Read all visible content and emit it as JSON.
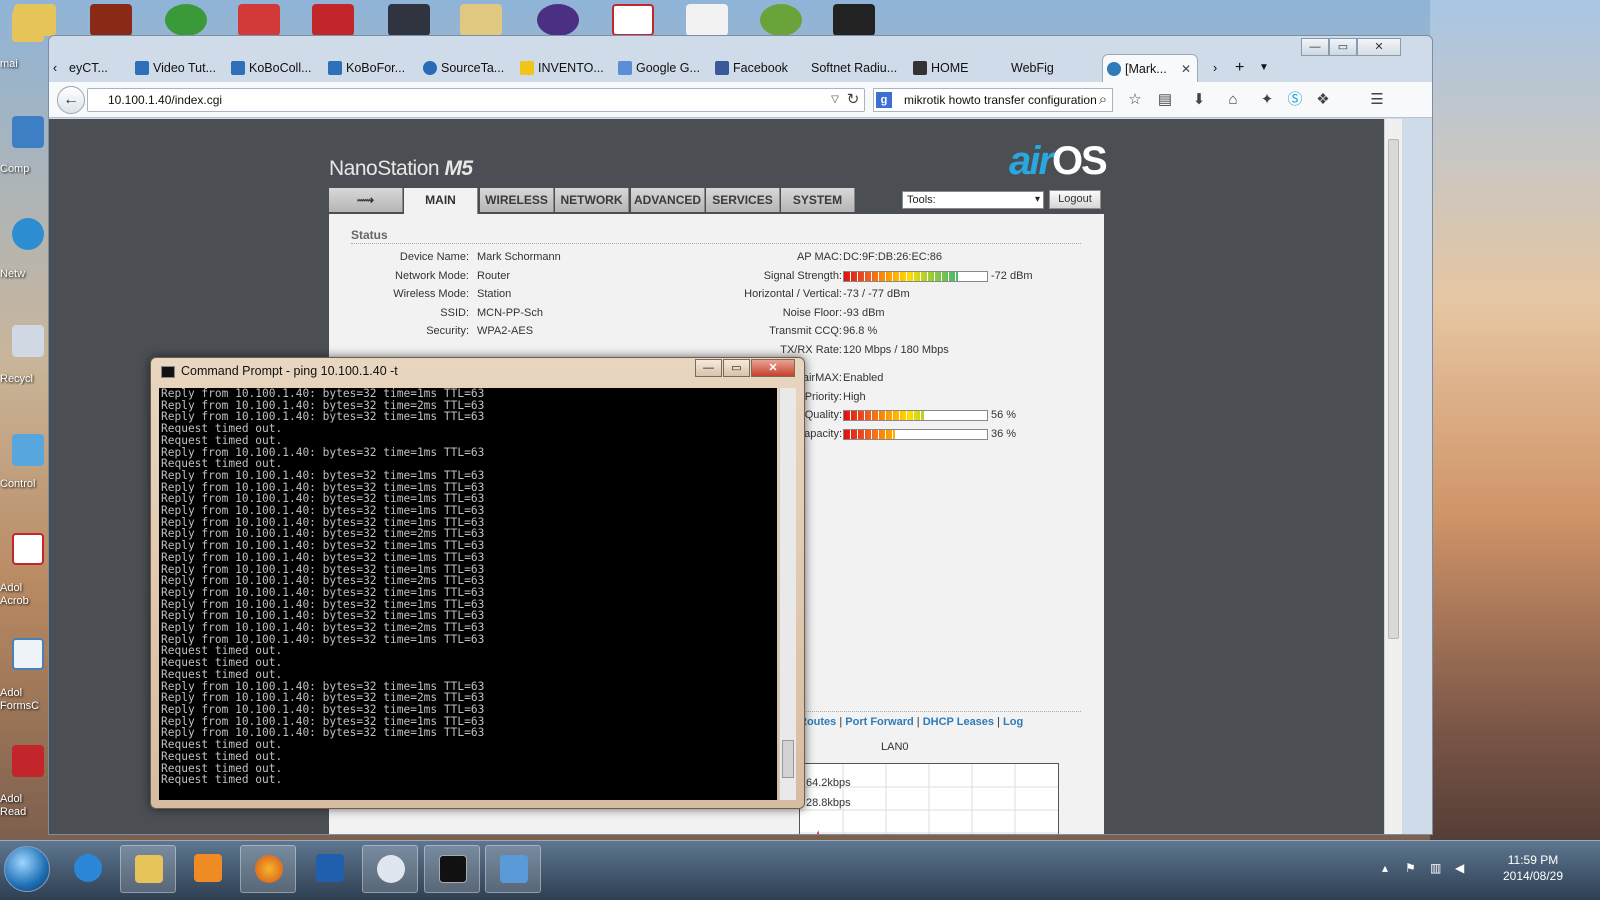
{
  "desktop": {
    "left_labels": [
      "mai",
      "Comp",
      "Netw",
      "Recycl",
      "Control",
      "Adol\nAcrob",
      "Adol\nFormsC",
      "Adol\nRead"
    ]
  },
  "browser": {
    "tabs": [
      {
        "label": "eyCT..."
      },
      {
        "label": "Video Tut..."
      },
      {
        "label": "KoBoColl..."
      },
      {
        "label": "KoBoFor..."
      },
      {
        "label": "SourceTa..."
      },
      {
        "label": "INVENTO..."
      },
      {
        "label": "Google G..."
      },
      {
        "label": "Facebook"
      },
      {
        "label": "Softnet Radiu..."
      },
      {
        "label": "HOME"
      },
      {
        "label": "WebFig"
      },
      {
        "label": "[Mark...",
        "active": true
      }
    ],
    "url": "10.100.1.40/index.cgi",
    "search_text": "mikrotik howto transfer configuration",
    "window_buttons": {
      "minimize": "—",
      "maximize": "▭",
      "close": "✕"
    }
  },
  "airos": {
    "brand_prefix": "NanoStation",
    "brand_model": "M5",
    "logo_air": "air",
    "logo_os": "OS",
    "nav_tabs": [
      "",
      "MAIN",
      "WIRELESS",
      "NETWORK",
      "ADVANCED",
      "SERVICES",
      "SYSTEM"
    ],
    "tools_label": "Tools:",
    "logout_label": "Logout",
    "status_title": "Status",
    "left": [
      {
        "label": "Device Name:",
        "value": "Mark Schormann"
      },
      {
        "label": "Network Mode:",
        "value": "Router"
      },
      {
        "label": "Wireless Mode:",
        "value": "Station"
      },
      {
        "label": "SSID:",
        "value": "MCN-PP-Sch"
      },
      {
        "label": "Security:",
        "value": "WPA2-AES"
      }
    ],
    "right": [
      {
        "label": "AP MAC:",
        "value": "DC:9F:DB:26:EC:86"
      },
      {
        "label": "Signal Strength:",
        "value": "-72 dBm",
        "level": 0.8
      },
      {
        "label": "Horizontal / Vertical:",
        "value": "-73 / -77 dBm"
      },
      {
        "label": "Noise Floor:",
        "value": "-93 dBm"
      },
      {
        "label": "Transmit CCQ:",
        "value": "96.8 %"
      },
      {
        "label": "TX/RX Rate:",
        "value": "120 Mbps / 180 Mbps"
      }
    ],
    "airmax": [
      {
        "label": "airMAX:",
        "value": "Enabled"
      },
      {
        "label": "MAX Priority:",
        "value": "High"
      },
      {
        "label": "MAX Quality:",
        "value": "56 %",
        "level": 0.56
      },
      {
        "label": "X Capacity:",
        "value": "36 %",
        "level": 0.36
      }
    ],
    "links": [
      "Routes",
      "Port Forward",
      "DHCP Leases",
      "Log"
    ],
    "graph_title": "LAN0",
    "graph_labels": [
      "64.2kbps",
      "28.8kbps"
    ]
  },
  "cmd": {
    "title": "Command Prompt - ping  10.100.1.40 -t",
    "lines": [
      "Reply from 10.100.1.40: bytes=32 time=1ms TTL=63",
      "Reply from 10.100.1.40: bytes=32 time=2ms TTL=63",
      "Reply from 10.100.1.40: bytes=32 time=1ms TTL=63",
      "Request timed out.",
      "Request timed out.",
      "Reply from 10.100.1.40: bytes=32 time=1ms TTL=63",
      "Request timed out.",
      "Reply from 10.100.1.40: bytes=32 time=1ms TTL=63",
      "Reply from 10.100.1.40: bytes=32 time=1ms TTL=63",
      "Reply from 10.100.1.40: bytes=32 time=1ms TTL=63",
      "Reply from 10.100.1.40: bytes=32 time=1ms TTL=63",
      "Reply from 10.100.1.40: bytes=32 time=1ms TTL=63",
      "Reply from 10.100.1.40: bytes=32 time=2ms TTL=63",
      "Reply from 10.100.1.40: bytes=32 time=1ms TTL=63",
      "Reply from 10.100.1.40: bytes=32 time=1ms TTL=63",
      "Reply from 10.100.1.40: bytes=32 time=1ms TTL=63",
      "Reply from 10.100.1.40: bytes=32 time=2ms TTL=63",
      "Reply from 10.100.1.40: bytes=32 time=1ms TTL=63",
      "Reply from 10.100.1.40: bytes=32 time=1ms TTL=63",
      "Reply from 10.100.1.40: bytes=32 time=1ms TTL=63",
      "Reply from 10.100.1.40: bytes=32 time=2ms TTL=63",
      "Reply from 10.100.1.40: bytes=32 time=1ms TTL=63",
      "Request timed out.",
      "Request timed out.",
      "Request timed out.",
      "Reply from 10.100.1.40: bytes=32 time=1ms TTL=63",
      "Reply from 10.100.1.40: bytes=32 time=2ms TTL=63",
      "Reply from 10.100.1.40: bytes=32 time=1ms TTL=63",
      "Reply from 10.100.1.40: bytes=32 time=1ms TTL=63",
      "Reply from 10.100.1.40: bytes=32 time=1ms TTL=63",
      "Request timed out.",
      "Request timed out.",
      "Request timed out.",
      "Request timed out."
    ]
  },
  "taskbar": {
    "time": "11:59 PM",
    "date": "2014/08/29"
  },
  "colors": {
    "airos_blue": "#29a8e0",
    "link_blue": "#2d7bb8",
    "graph_red": "#e02020",
    "graph_blue": "#3a7fc8"
  }
}
